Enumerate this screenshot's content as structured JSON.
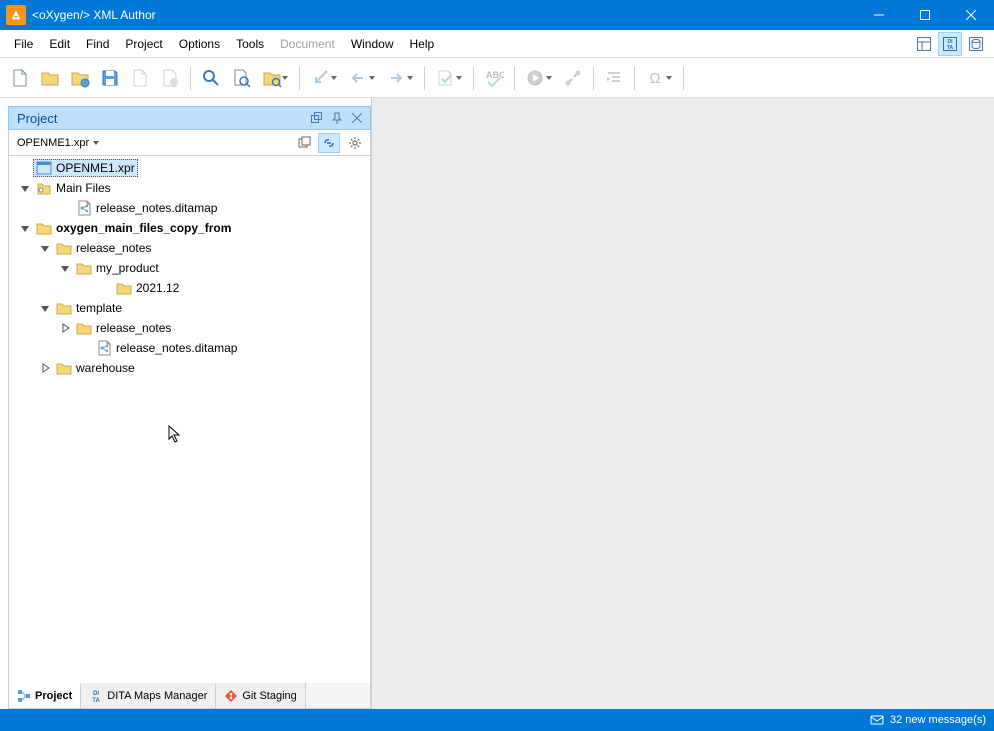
{
  "window": {
    "title": "<oXygen/> XML Author"
  },
  "menu": {
    "items": [
      "File",
      "Edit",
      "Find",
      "Project",
      "Options",
      "Tools",
      "Document",
      "Window",
      "Help"
    ],
    "disabled_index": 6
  },
  "toolbar_right_icons": [
    "perspective-layout-icon",
    "dita-perspective-icon",
    "db-perspective-icon"
  ],
  "panel": {
    "title": "Project",
    "selector": "OPENME1.xpr"
  },
  "tree": [
    {
      "depth": 0,
      "expand": "none",
      "icon": "project",
      "label": "OPENME1.xpr",
      "selected": true
    },
    {
      "depth": 0,
      "expand": "open",
      "icon": "mainfiles",
      "label": "Main Files"
    },
    {
      "depth": 1,
      "expand": "none2",
      "icon": "ditamap",
      "label": "release_notes.ditamap"
    },
    {
      "depth": 0,
      "expand": "open",
      "icon": "folder",
      "label": "oxygen_main_files_copy_from",
      "bold": true
    },
    {
      "depth": 1,
      "expand": "open",
      "icon": "folder",
      "label": "release_notes"
    },
    {
      "depth": 2,
      "expand": "open",
      "icon": "folder",
      "label": "my_product"
    },
    {
      "depth": 3,
      "expand": "none2",
      "icon": "folder",
      "label": "2021.12"
    },
    {
      "depth": 1,
      "expand": "open",
      "icon": "folder",
      "label": "template"
    },
    {
      "depth": 2,
      "expand": "closed",
      "icon": "folder",
      "label": "release_notes"
    },
    {
      "depth": 2,
      "expand": "none2",
      "icon": "ditamap",
      "label": "release_notes.ditamap"
    },
    {
      "depth": 1,
      "expand": "closed",
      "icon": "folder",
      "label": "warehouse"
    }
  ],
  "bottom_tabs": [
    {
      "label": "Project",
      "icon": "tree-icon",
      "active": true
    },
    {
      "label": "DITA Maps Manager",
      "icon": "dita-icon",
      "active": false
    },
    {
      "label": "Git Staging",
      "icon": "git-icon",
      "active": false
    }
  ],
  "status": {
    "messages": "32 new message(s)"
  }
}
